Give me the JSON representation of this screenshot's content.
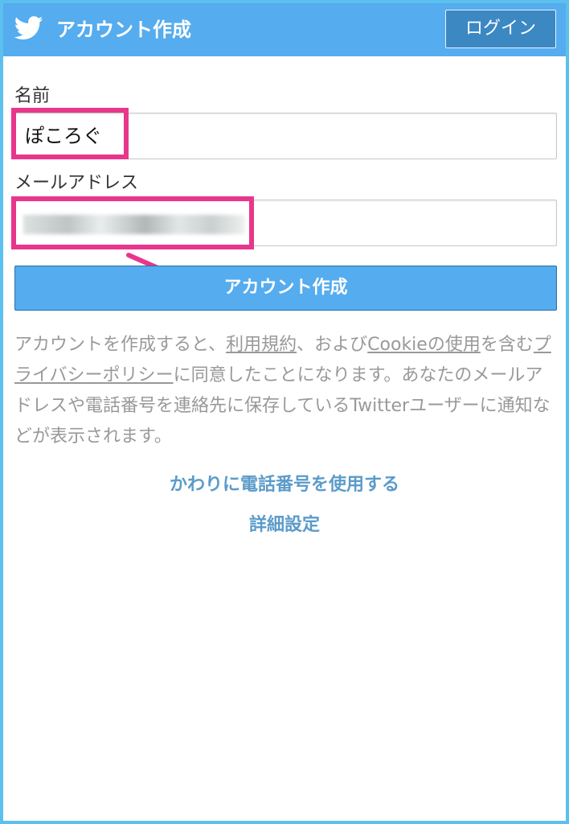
{
  "header": {
    "title": "アカウント作成",
    "login_label": "ログイン",
    "bird_icon": "twitter-bird-icon"
  },
  "form": {
    "name_label": "名前",
    "name_value": "ぽころぐ",
    "email_label": "メールアドレス",
    "create_label": "アカウント作成"
  },
  "terms": {
    "part1": "アカウントを作成すると、",
    "link_tos": "利用規約",
    "part2": "、および",
    "link_cookie": "Cookieの使用",
    "part3": "を含む",
    "link_privacy": "プライバシーポリシー",
    "part4": "に同意したことになります。あなたのメールアドレスや電話番号を連絡先に保存しているTwitterユーザーに通知などが表示されます。"
  },
  "links": {
    "use_phone": "かわりに電話番号を使用する",
    "advanced": "詳細設定"
  },
  "colors": {
    "accent": "#55acee",
    "highlight": "#e8368c",
    "frame": "#5cc0ef"
  }
}
